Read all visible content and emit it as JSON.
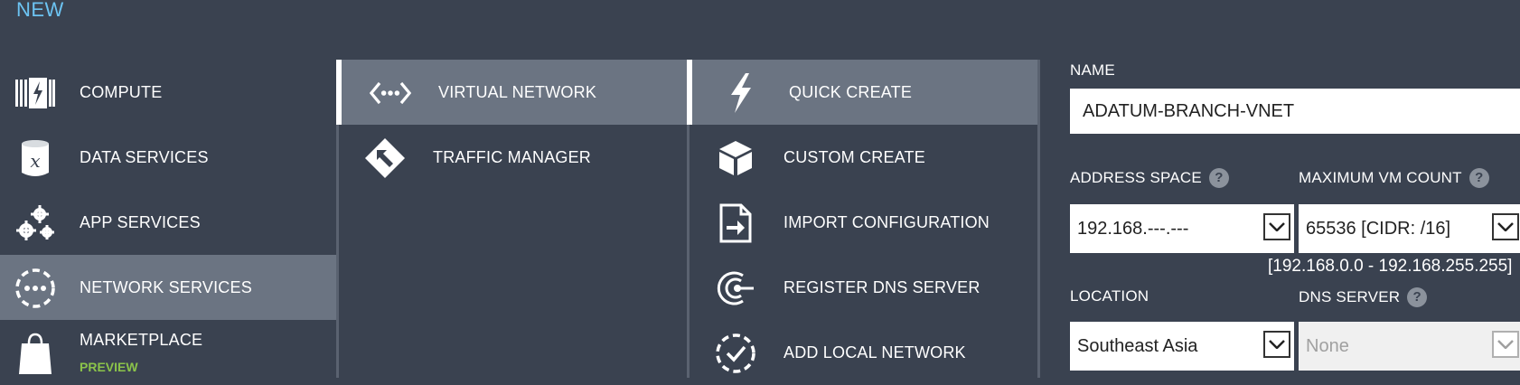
{
  "header": {
    "title": "NEW"
  },
  "categories": [
    {
      "label": "COMPUTE",
      "icon": "compute-icon"
    },
    {
      "label": "DATA SERVICES",
      "icon": "data-services-icon"
    },
    {
      "label": "APP SERVICES",
      "icon": "gears-icon"
    },
    {
      "label": "NETWORK SERVICES",
      "icon": "network-icon",
      "selected": true
    },
    {
      "label": "MARKETPLACE",
      "sublabel": "PREVIEW",
      "icon": "shopping-bag-icon"
    }
  ],
  "network_services": [
    {
      "label": "VIRTUAL NETWORK",
      "icon": "virtual-network-icon",
      "selected": true
    },
    {
      "label": "TRAFFIC MANAGER",
      "icon": "traffic-manager-icon"
    }
  ],
  "create_options": [
    {
      "label": "QUICK CREATE",
      "icon": "lightning-icon",
      "selected": true
    },
    {
      "label": "CUSTOM CREATE",
      "icon": "box-icon"
    },
    {
      "label": "IMPORT CONFIGURATION",
      "icon": "import-file-icon"
    },
    {
      "label": "REGISTER DNS SERVER",
      "icon": "dns-server-icon"
    },
    {
      "label": "ADD LOCAL NETWORK",
      "icon": "local-network-icon"
    }
  ],
  "form": {
    "name_label": "NAME",
    "name_value": "ADATUM-BRANCH-VNET",
    "address_space_label": "ADDRESS SPACE",
    "address_space_value": "192.168.---.---",
    "max_vm_label": "MAXIMUM VM COUNT",
    "max_vm_value": "65536 [CIDR: /16]",
    "range_text": "[192.168.0.0 - 192.168.255.255]",
    "location_label": "LOCATION",
    "location_value": "Southeast Asia",
    "dns_label": "DNS SERVER",
    "dns_value": "None",
    "help_glyph": "?"
  }
}
